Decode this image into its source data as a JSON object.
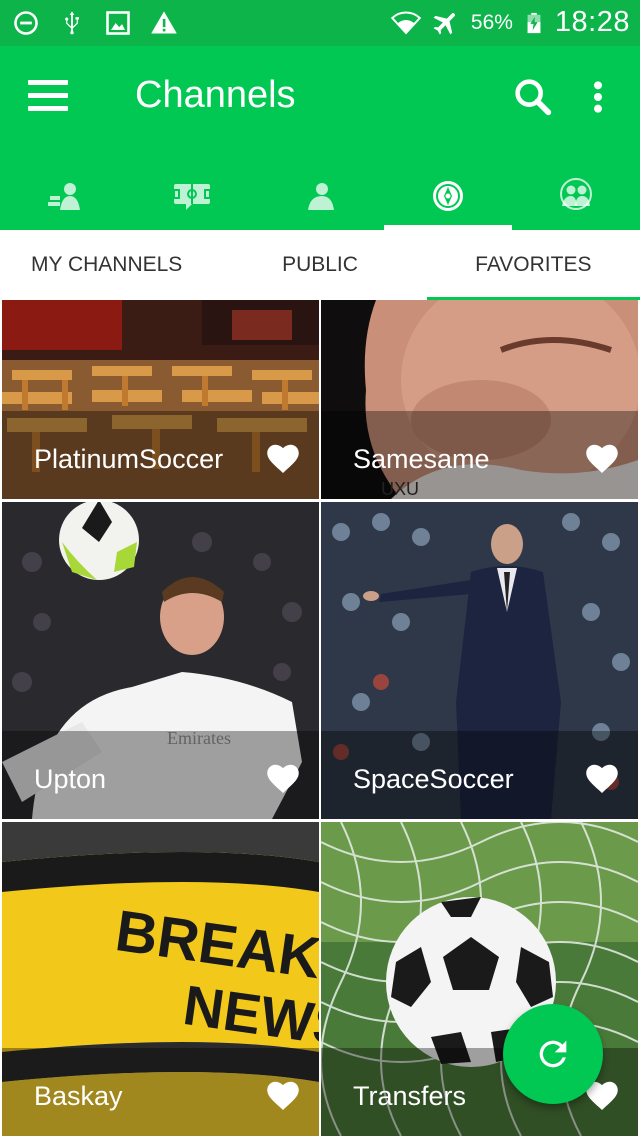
{
  "status_bar": {
    "icons_left": [
      "do-not-disturb-icon",
      "usb-icon",
      "image-icon",
      "warning-icon"
    ],
    "icons_right": [
      "wifi-icon",
      "airplane-mode-icon",
      "battery-charging-icon"
    ],
    "battery_percent": "56%",
    "time": "18:28"
  },
  "app_bar": {
    "title": "Channels",
    "actions": [
      "menu-icon",
      "search-icon",
      "more-vert-icon"
    ]
  },
  "icon_tabs": [
    {
      "icon": "people-chat-icon",
      "active": false
    },
    {
      "icon": "football-pitch-icon",
      "active": false
    },
    {
      "icon": "person-icon",
      "active": false
    },
    {
      "icon": "channels-disc-icon",
      "active": true
    },
    {
      "icon": "group-icon",
      "active": false
    }
  ],
  "sub_tabs": [
    {
      "label": "MY CHANNELS",
      "active": false
    },
    {
      "label": "PUBLIC",
      "active": false
    },
    {
      "label": "FAVORITES",
      "active": true
    }
  ],
  "channels": [
    {
      "name": "PlatinumSoccer",
      "favorite": true,
      "image": "sports-bar-restaurant"
    },
    {
      "name": "Samesame",
      "favorite": true,
      "image": "footballer-face-closeup"
    },
    {
      "name": "Upton",
      "favorite": true,
      "image": "footballer-with-ball"
    },
    {
      "name": "SpaceSoccer",
      "favorite": true,
      "image": "coach-pointing-stadium"
    },
    {
      "name": "Baskay",
      "favorite": true,
      "image": "breaking-news-logo"
    },
    {
      "name": "Transfers",
      "favorite": true,
      "image": "soccer-ball-in-net"
    }
  ],
  "fab": {
    "icon": "refresh-icon"
  },
  "colors": {
    "status_bar": "#0cb44a",
    "primary": "#00c853",
    "tab_text": "#333333"
  }
}
